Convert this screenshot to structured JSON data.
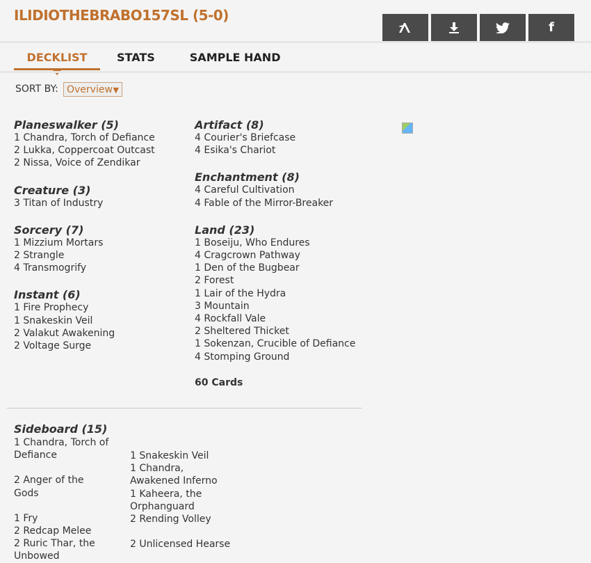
{
  "header": {
    "title": "ILIDIOTHEBRABO157SL (5-0)",
    "buttons": [
      {
        "icon": "arena-icon",
        "glyph": "ʌ"
      },
      {
        "icon": "download-icon"
      },
      {
        "icon": "twitter-icon"
      },
      {
        "icon": "facebook-icon",
        "glyph": "f"
      }
    ]
  },
  "tabs": [
    "DECKLIST",
    "STATS",
    "SAMPLE HAND"
  ],
  "sort": {
    "label": "SORT BY:",
    "selected": "Overview"
  },
  "left_column": [
    {
      "category": "Planeswalker (5)",
      "cards": [
        "1 Chandra, Torch of Defiance",
        "2 Lukka, Coppercoat Outcast",
        "2 Nissa, Voice of Zendikar"
      ]
    },
    {
      "category": "Creature (3)",
      "cards": [
        "3 Titan of Industry"
      ]
    },
    {
      "category": "Sorcery (7)",
      "cards": [
        "1 Mizzium Mortars",
        "2 Strangle",
        "4 Transmogrify"
      ]
    },
    {
      "category": "Instant (6)",
      "cards": [
        "1 Fire Prophecy",
        "1 Snakeskin Veil",
        "2 Valakut Awakening",
        "2 Voltage Surge"
      ]
    }
  ],
  "right_column": [
    {
      "category": "Artifact (8)",
      "cards": [
        "4 Courier's Briefcase",
        "4 Esika's Chariot"
      ]
    },
    {
      "category": "Enchantment (8)",
      "cards": [
        "4 Careful Cultivation",
        "4 Fable of the Mirror-Breaker"
      ]
    },
    {
      "category": "Land (23)",
      "cards": [
        "1 Boseiju, Who Endures",
        "4 Cragcrown Pathway",
        "1 Den of the Bugbear",
        "2 Forest",
        "1 Lair of the Hydra",
        "3 Mountain",
        "4 Rockfall Vale",
        "2 Sheltered Thicket",
        "1 Sokenzan, Crucible of Defiance",
        "4 Stomping Ground"
      ]
    }
  ],
  "total": "60 Cards",
  "sideboard": {
    "category": "Sideboard (15)",
    "col1": [
      "1 Chandra, Torch of Defiance",
      "2 Anger of the Gods",
      "1 Fry",
      "2 Redcap Melee",
      "2 Ruric Thar, the Unbowed"
    ],
    "col2": [
      "1 Snakeskin Veil",
      "1 Chandra, Awakened Inferno",
      "1 Kaheera, the Orphanguard",
      "2 Rending Volley",
      "2 Unlicensed Hearse"
    ]
  },
  "colors": {
    "accent": "#c0712e",
    "button_bg": "#4a4a4a",
    "background": "#f4f4f4"
  }
}
